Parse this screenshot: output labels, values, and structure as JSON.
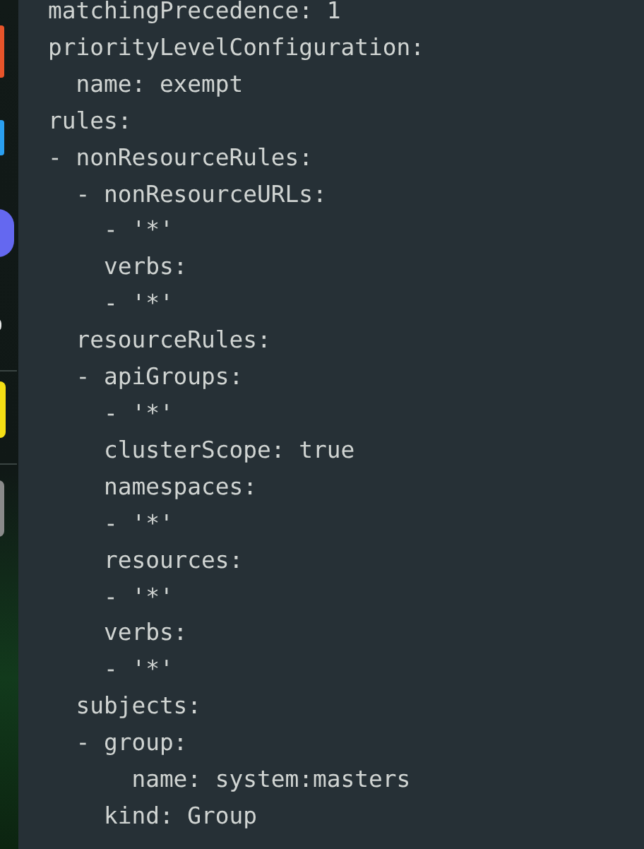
{
  "dock": {
    "apps": [
      {
        "color": "#e8542a"
      },
      {
        "color": "#2a9ff0"
      },
      {
        "color": "#6468f0"
      },
      {
        "color": "#e6e6e6"
      },
      {
        "color": "#f5df14"
      },
      {
        "color": "#8a8a8a"
      }
    ]
  },
  "editor": {
    "lines": [
      "matchingPrecedence: 1",
      "priorityLevelConfiguration:",
      "  name: exempt",
      "rules:",
      "- nonResourceRules:",
      "  - nonResourceURLs:",
      "    - '*'",
      "    verbs:",
      "    - '*'",
      "  resourceRules:",
      "  - apiGroups:",
      "    - '*'",
      "    clusterScope: true",
      "    namespaces:",
      "    - '*'",
      "    resources:",
      "    - '*'",
      "    verbs:",
      "    - '*'",
      "  subjects:",
      "  - group:",
      "      name: system:masters",
      "    kind: Group"
    ]
  }
}
